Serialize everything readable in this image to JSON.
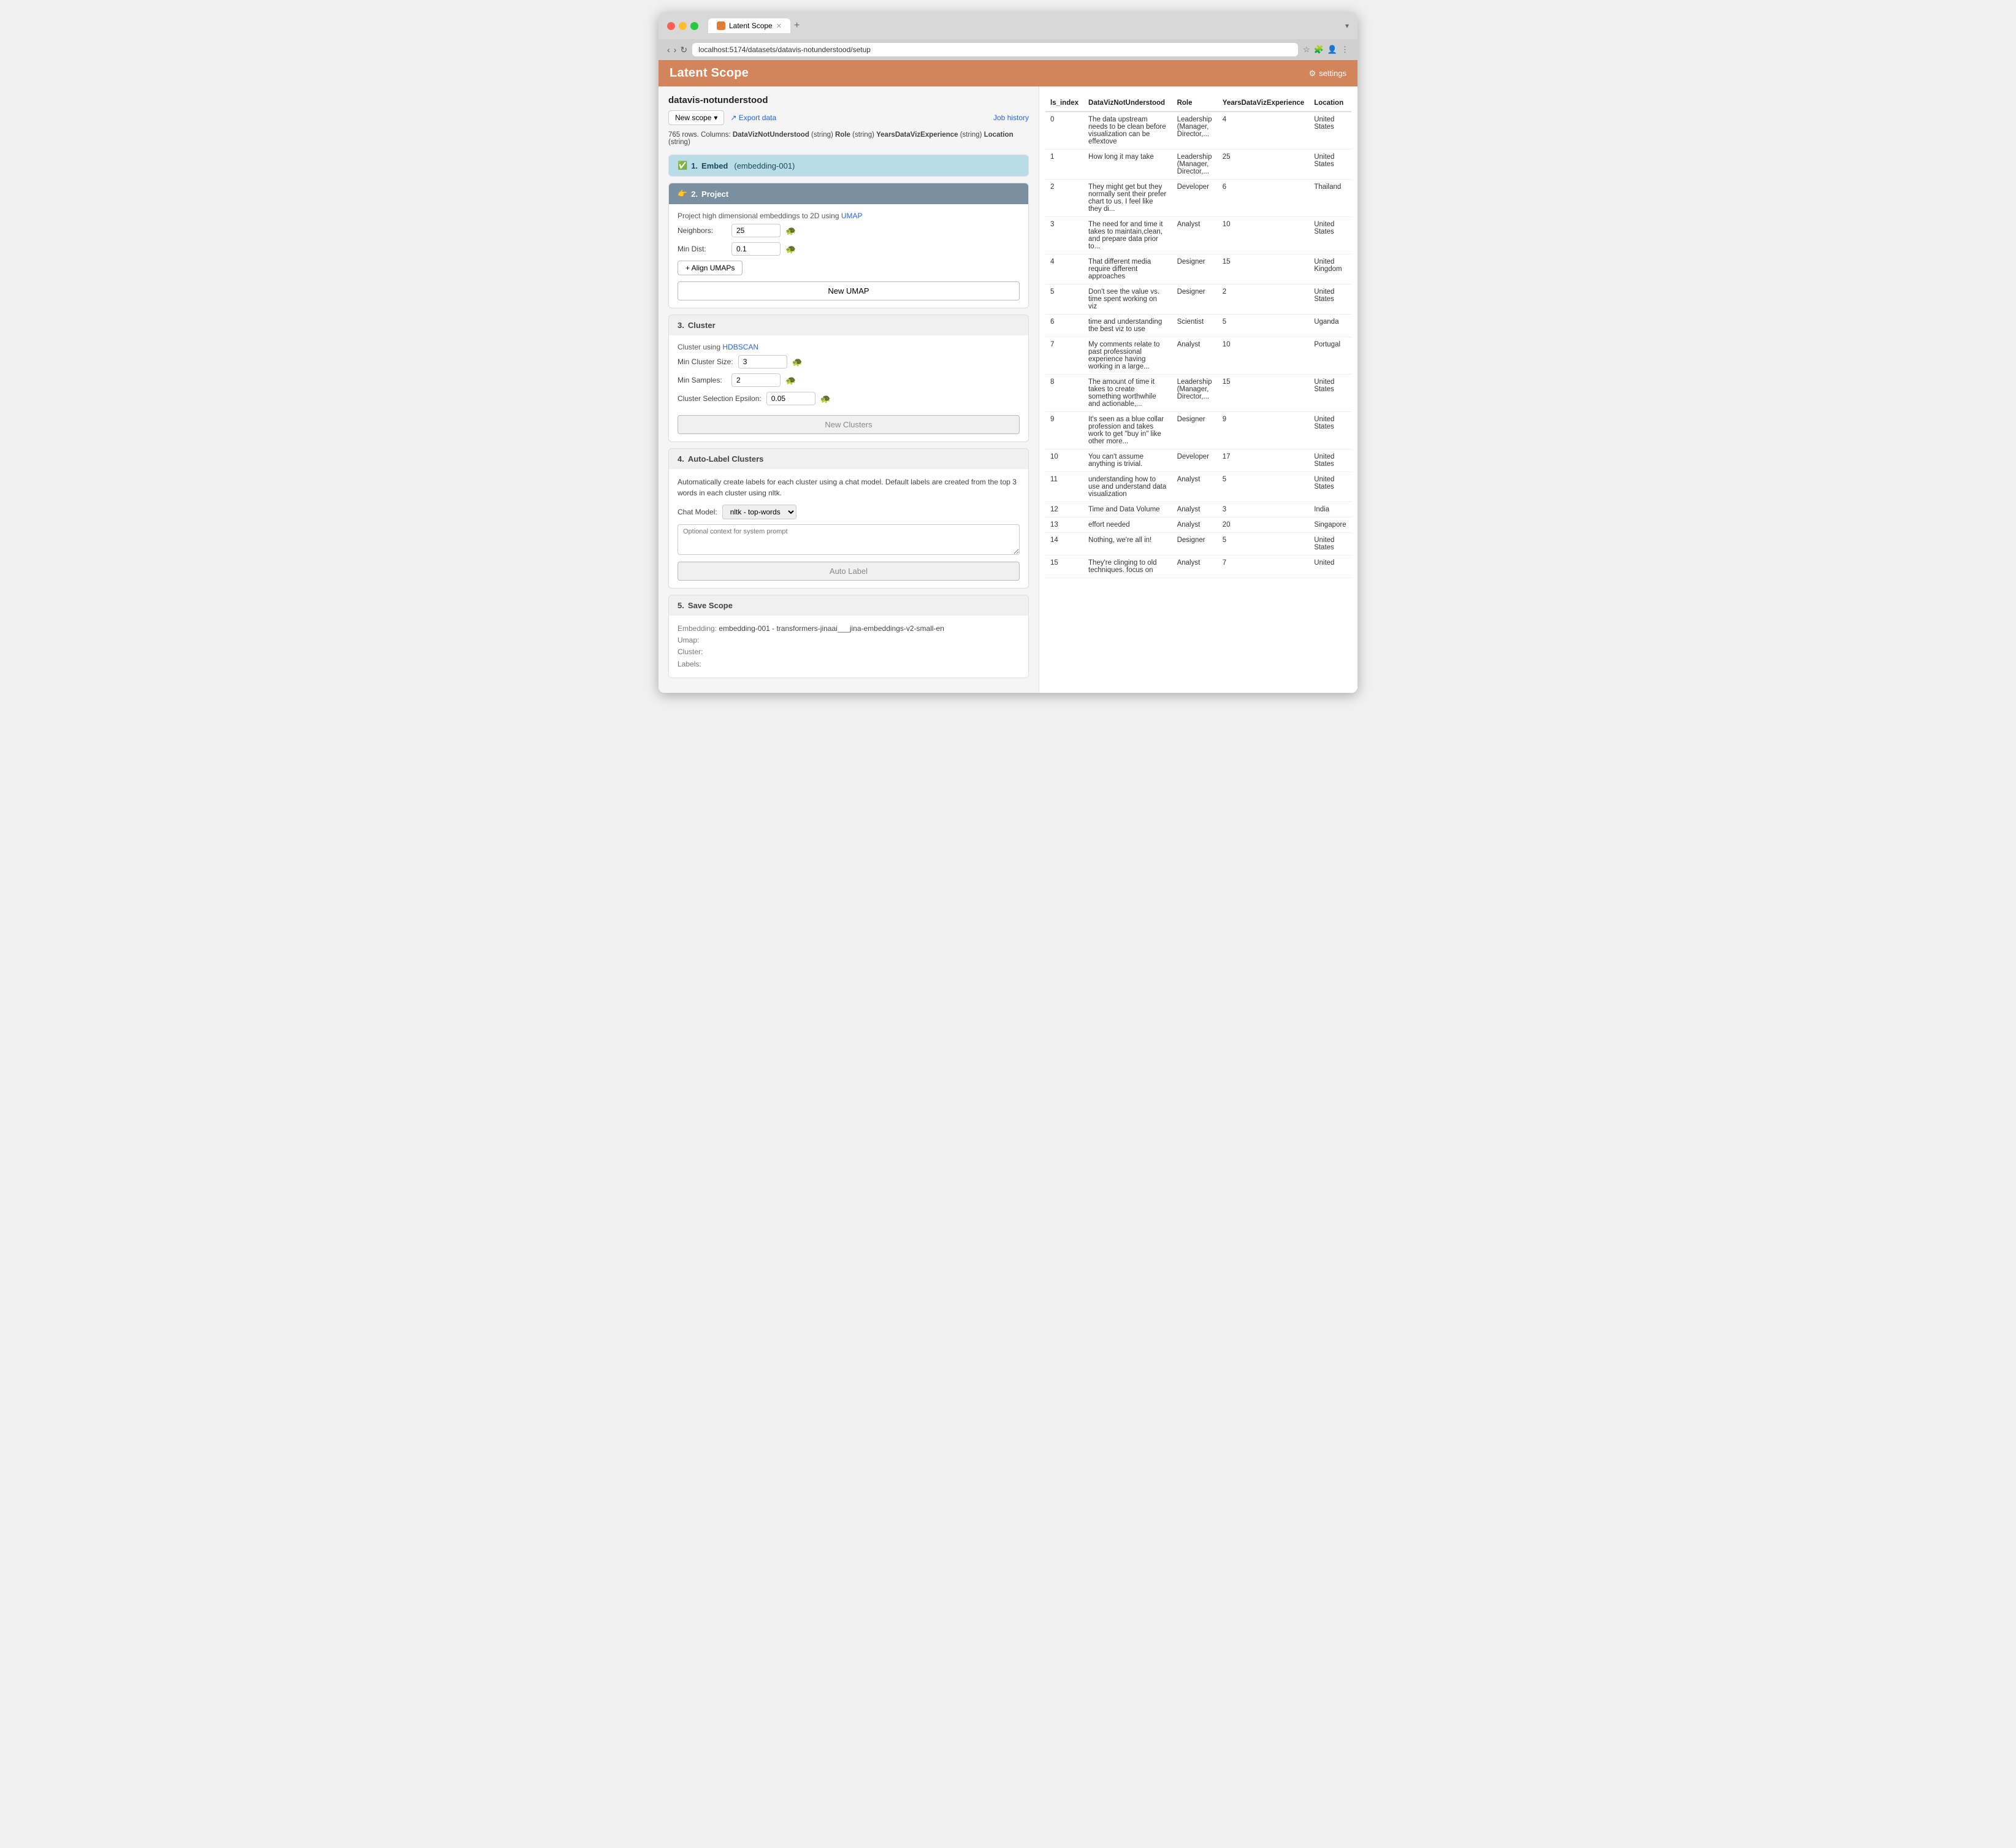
{
  "browser": {
    "tab_label": "Latent Scope",
    "tab_icon": "latent-scope-icon",
    "address": "localhost:5174/datasets/datavis-notunderstood/setup",
    "new_tab_icon": "+",
    "expand_icon": "▾"
  },
  "header": {
    "title": "Latent Scope",
    "settings_label": "settings",
    "settings_icon": "⚙"
  },
  "toolbar": {
    "new_scope_label": "New scope",
    "new_scope_chevron": "▾",
    "export_label": "↗ Export data",
    "job_history_label": "Job history"
  },
  "dataset": {
    "name": "datavis-notunderstood",
    "meta": "765 rows. Columns:",
    "columns": [
      {
        "name": "DataVizNotUnderstood",
        "type": "(string)"
      },
      {
        "name": "Role",
        "type": "(string)"
      },
      {
        "name": "YearsDataVizExperience",
        "type": "(string)"
      },
      {
        "name": "Location",
        "type": "(string)"
      }
    ]
  },
  "steps": {
    "embed": {
      "number": "1.",
      "label": "Embed",
      "suffix": "(embedding-001)",
      "icon": "✅",
      "status": "completed"
    },
    "project": {
      "number": "2.",
      "label": "Project",
      "icon": "👉",
      "status": "active",
      "description": "Project high dimensional embeddings to 2D using",
      "umap_link": "UMAP",
      "neighbors_label": "Neighbors:",
      "neighbors_value": "25",
      "min_dist_label": "Min Dist:",
      "min_dist_value": "0.1",
      "align_btn": "+ Align UMAPs",
      "new_umap_btn": "New UMAP"
    },
    "cluster": {
      "number": "3.",
      "label": "Cluster",
      "icon": "",
      "status": "inactive",
      "description": "Cluster using",
      "hdbscan_link": "HDBSCAN",
      "min_cluster_size_label": "Min Cluster Size:",
      "min_cluster_size_value": "3",
      "min_samples_label": "Min Samples:",
      "min_samples_value": "2",
      "epsilon_label": "Cluster Selection Epsilon:",
      "epsilon_value": "0.05",
      "new_clusters_btn": "New Clusters"
    },
    "auto_label": {
      "number": "4.",
      "label": "Auto-Label Clusters",
      "icon": "",
      "status": "inactive",
      "description": "Automatically create labels for each cluster using a chat model. Default labels are created from the top 3 words in each cluster using nltk.",
      "chat_model_label": "Chat Model:",
      "chat_model_value": "nltk - top-words",
      "context_placeholder": "Optional context for system prompt",
      "auto_label_btn": "Auto Label"
    },
    "save": {
      "number": "5.",
      "label": "Save Scope",
      "icon": "",
      "status": "inactive",
      "embedding_label": "Embedding:",
      "embedding_value": "embedding-001 - transformers-jinaai___jina-embeddings-v2-small-en",
      "umap_label": "Umap:",
      "umap_value": "",
      "cluster_label": "Cluster:",
      "cluster_value": "",
      "labels_label": "Labels:",
      "labels_value": ""
    }
  },
  "table": {
    "columns": [
      "ls_index",
      "DataVizNotUnderstood",
      "Role",
      "YearsDataVizExperience",
      "Location"
    ],
    "rows": [
      {
        "index": "0",
        "text": "The data upstream needs to be clean before visualization can be effextove",
        "role": "Leadership (Manager, Director,...",
        "years": "4",
        "location": "United States"
      },
      {
        "index": "1",
        "text": "How long it may take",
        "role": "Leadership (Manager, Director,...",
        "years": "25",
        "location": "United States"
      },
      {
        "index": "2",
        "text": "They might get but they normally sent their prefer chart to us. I feel like they di...",
        "role": "Developer",
        "years": "6",
        "location": "Thailand"
      },
      {
        "index": "3",
        "text": "The need for and time it takes to maintain,clean, and prepare data prior to...",
        "role": "Analyst",
        "years": "10",
        "location": "United States"
      },
      {
        "index": "4",
        "text": "That different media require different approaches",
        "role": "Designer",
        "years": "15",
        "location": "United Kingdom"
      },
      {
        "index": "5",
        "text": "Don't see the value vs. time spent working on viz",
        "role": "Designer",
        "years": "2",
        "location": "United States"
      },
      {
        "index": "6",
        "text": "time and understanding the best viz to use",
        "role": "Scientist",
        "years": "5",
        "location": "Uganda"
      },
      {
        "index": "7",
        "text": "My comments relate to past professional experience having working in a large...",
        "role": "Analyst",
        "years": "10",
        "location": "Portugal"
      },
      {
        "index": "8",
        "text": "The amount of time it takes to create something worthwhile and actionable,...",
        "role": "Leadership (Manager, Director,...",
        "years": "15",
        "location": "United States"
      },
      {
        "index": "9",
        "text": "It's seen as a blue collar profession and takes work to get \"buy in\" like other more...",
        "role": "Designer",
        "years": "9",
        "location": "United States"
      },
      {
        "index": "10",
        "text": "You can't assume anything is trivial.",
        "role": "Developer",
        "years": "17",
        "location": "United States"
      },
      {
        "index": "11",
        "text": "understanding how to use and understand data visualization",
        "role": "Analyst",
        "years": "5",
        "location": "United States"
      },
      {
        "index": "12",
        "text": "Time and Data Volume",
        "role": "Analyst",
        "years": "3",
        "location": "India"
      },
      {
        "index": "13",
        "text": "effort needed",
        "role": "Analyst",
        "years": "20",
        "location": "Singapore"
      },
      {
        "index": "14",
        "text": "Nothing, we're all in!",
        "role": "Designer",
        "years": "5",
        "location": "United States"
      },
      {
        "index": "15",
        "text": "They're clinging to old techniques. focus on",
        "role": "Analyst",
        "years": "7",
        "location": "United"
      }
    ]
  },
  "chat_model_options": [
    "nltk - top-words"
  ]
}
